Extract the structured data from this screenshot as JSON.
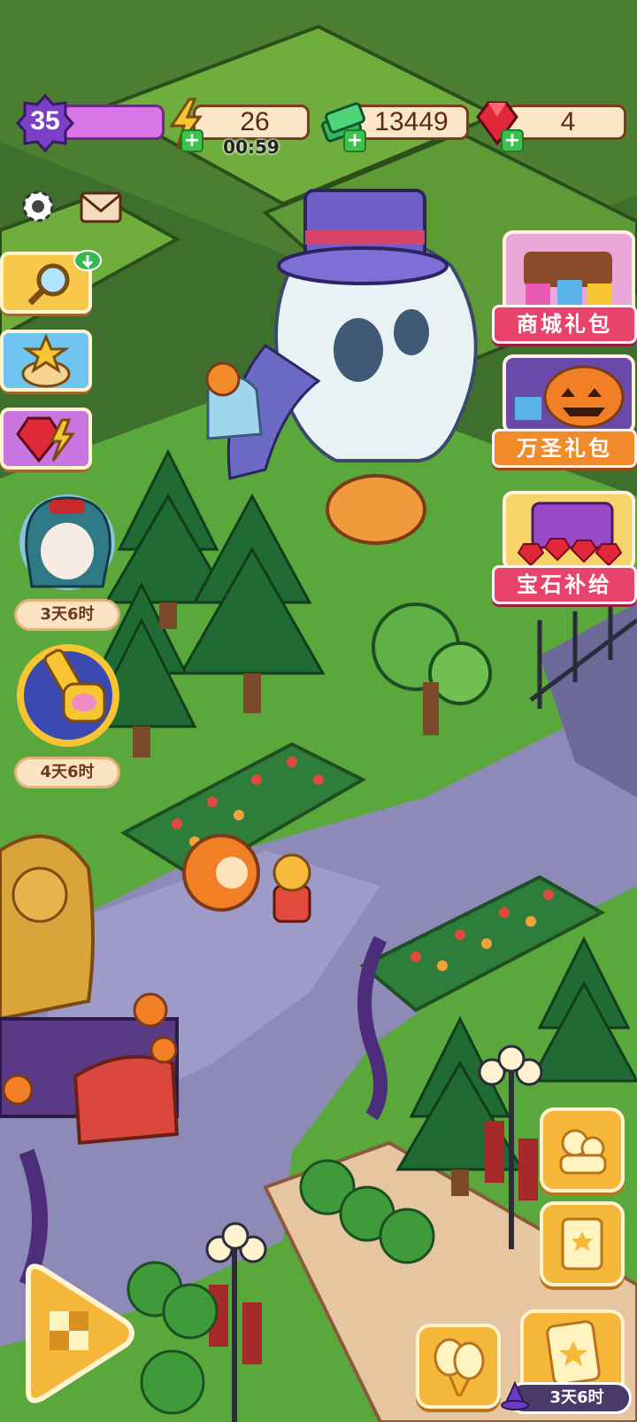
{
  "hud": {
    "level": "35",
    "energy": "26",
    "energy_timer": "00:59",
    "cash": "13449",
    "gems": "4"
  },
  "left_timers": {
    "character_timer": "3天6时",
    "key_timer": "4天6时"
  },
  "right_offers": {
    "shop_pack": "商城礼包",
    "halloween_pack": "万圣礼包",
    "gem_supply": "宝石补给"
  },
  "bottom": {
    "event_timer": "3天6时"
  },
  "colors": {
    "grass": "#5aa83c",
    "path": "#8d8ab8",
    "accent_orange": "#f5b73a",
    "label_pink": "#e8446b"
  },
  "icons": {
    "level": "purple-badge",
    "energy": "lightning-icon",
    "cash": "cash-stack-icon",
    "gems": "ruby-icon",
    "settings": "gear-icon",
    "mail": "envelope-icon"
  }
}
